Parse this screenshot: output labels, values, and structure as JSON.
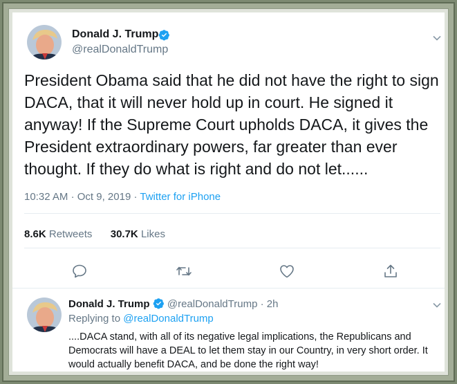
{
  "main_tweet": {
    "author_name": "Donald J. Trump",
    "author_handle": "@realDonaldTrump",
    "text": "President Obama said that he did not have the right to sign DACA, that it will never hold up in court. He signed it anyway! If the Supreme Court upholds DACA, it gives the President extraordinary powers, far greater than ever thought. If they do what is right and do not let......",
    "time": "10:32 AM",
    "date": "Oct 9, 2019",
    "separator": "·",
    "source": "Twitter for iPhone",
    "retweets_count": "8.6K",
    "retweets_label": "Retweets",
    "likes_count": "30.7K",
    "likes_label": "Likes"
  },
  "reply_tweet": {
    "author_name": "Donald J. Trump",
    "author_handle": "@realDonaldTrump",
    "separator": "·",
    "age": "2h",
    "replying_to_label": "Replying to",
    "replying_to_handle": "@realDonaldTrump",
    "text": "....DACA stand, with all of its negative legal implications, the Republicans and Democrats will have a DEAL to let them stay in our Country, in very short order. It would actually benefit DACA, and be done the right way!"
  },
  "icons": {
    "verified": "verified-badge-icon",
    "caret": "chevron-down-icon",
    "reply": "reply-icon",
    "retweet": "retweet-icon",
    "like": "heart-icon",
    "share": "share-icon"
  },
  "colors": {
    "accent": "#1da1f2",
    "secondary_text": "#657786",
    "primary_text": "#14171a",
    "frame": "#7d8a72"
  }
}
